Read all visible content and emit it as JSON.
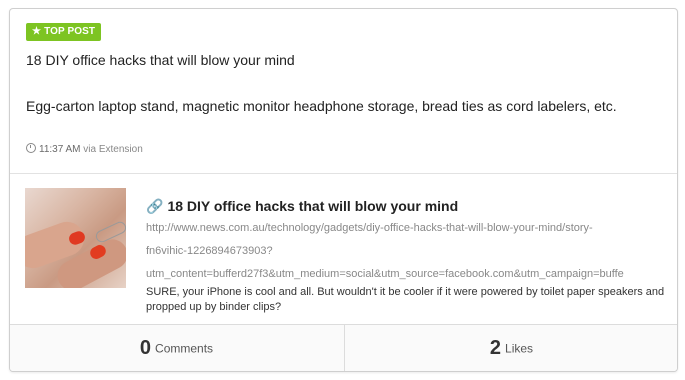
{
  "post": {
    "badge": "TOP POST",
    "title": "18 DIY office hacks that will blow your mind",
    "description": "Egg-carton laptop stand, magnetic monitor headphone storage, bread ties as cord labelers, etc.",
    "time": "11:37 AM",
    "source": "via Extension"
  },
  "link": {
    "title": "18 DIY office hacks that will blow your mind",
    "url_lines": [
      "http://www.news.com.au/technology/gadgets/diy-office-hacks-that-will-blow-your-mind/story-",
      "fn6vihic-1226894673903?",
      "utm_content=bufferd27f3&utm_medium=social&utm_source=facebook.com&utm_campaign=buffe"
    ],
    "description": "SURE, your iPhone is cool and all. But wouldn't it be cooler if it were powered by toilet paper speakers and propped up by binder clips?",
    "icon": "link-icon"
  },
  "stats": {
    "comments_count": "0",
    "comments_label": "Comments",
    "likes_count": "2",
    "likes_label": "Likes"
  },
  "colors": {
    "badge": "#7dc422",
    "text": "#222222",
    "muted": "#888888"
  }
}
